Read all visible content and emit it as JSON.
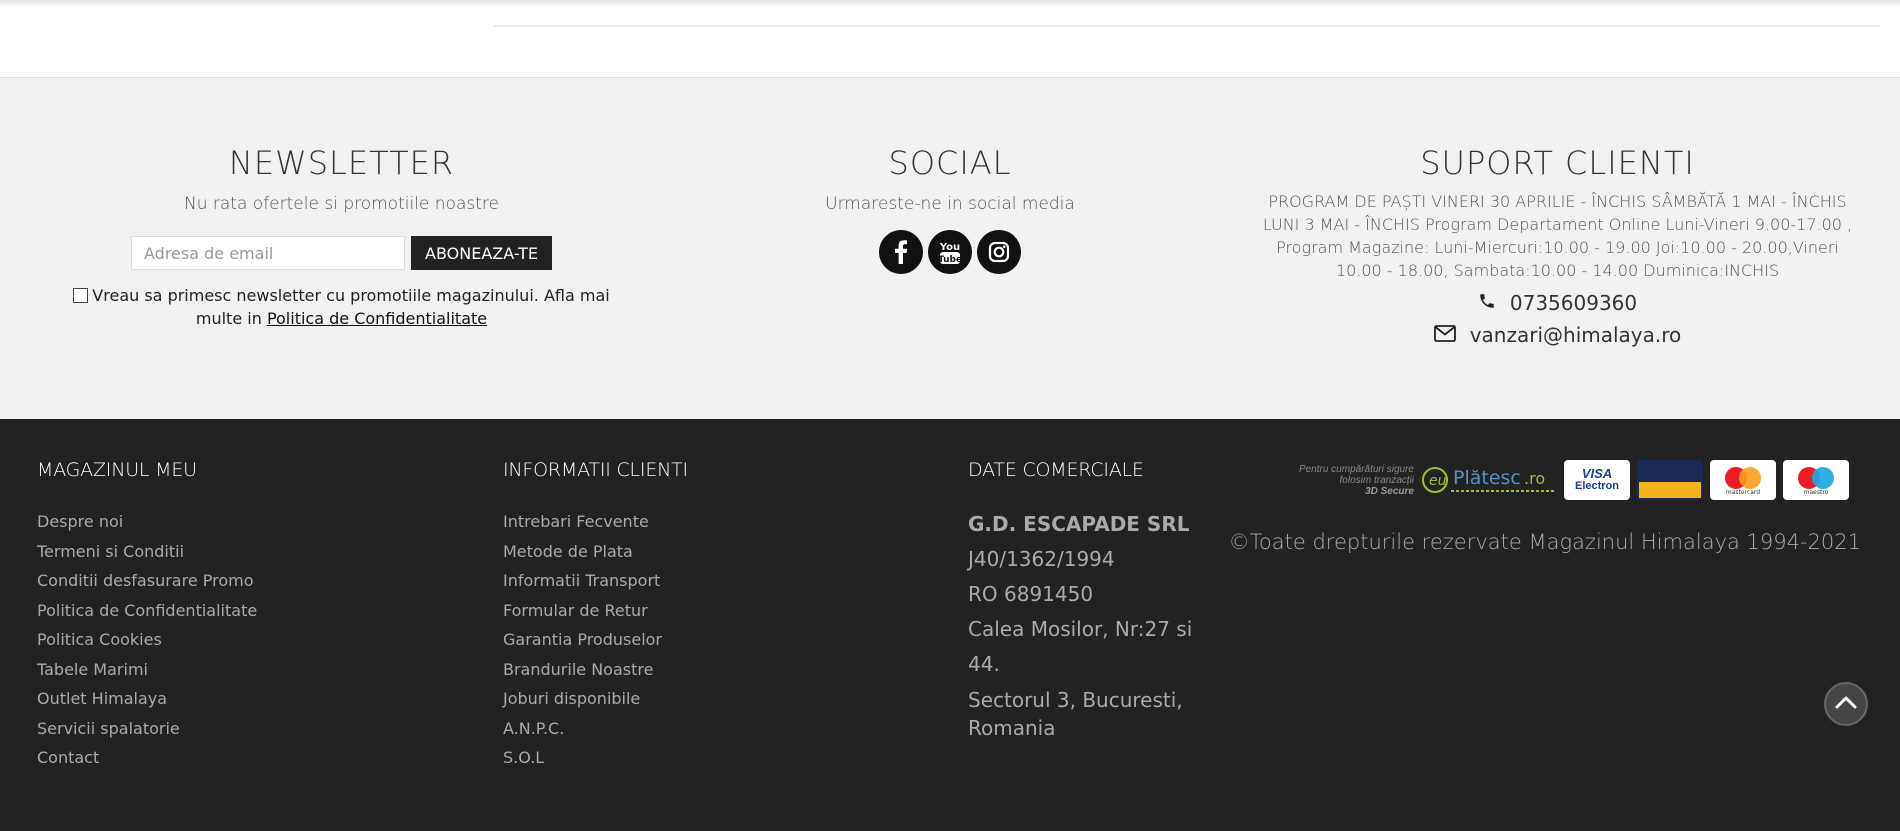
{
  "newsletter": {
    "title": "NEWSLETTER",
    "subtitle": "Nu rata ofertele si promotiile noastre",
    "email_placeholder": "Adresa de email",
    "subscribe_label": "ABONEAZA-TE",
    "consent_text": "Vreau sa primesc newsletter cu promotiile magazinului. Afla mai multe in",
    "consent_link": "Politica de Confidentialitate"
  },
  "social": {
    "title": "SOCIAL",
    "subtitle": "Urmareste-ne in social media",
    "icons": [
      "facebook-icon",
      "youtube-icon",
      "instagram-icon"
    ]
  },
  "support": {
    "title": "SUPORT CLIENTI",
    "schedule": "PROGRAM DE PAȘTI VINERI 30 APRILIE - ÎNCHIS SÂMBĂTĂ 1 MAI - ÎNCHIS LUNI 3 MAI - ÎNCHIS Program Departament Online Luni-Vineri 9.00-17.00 , Program Magazine: Luni-Miercuri:10.00 - 19.00 Joi:10.00 - 20.00,Vineri 10.00 - 18.00, Sambata:10.00 - 14.00 Duminica:INCHIS",
    "phone": "0735609360",
    "email": "vanzari@himalaya.ro"
  },
  "footer": {
    "magazin": {
      "title": "MAGAZINUL MEU",
      "items": [
        "Despre noi",
        "Termeni si Conditii",
        "Conditii desfasurare Promo",
        "Politica de Confidentialitate",
        "Politica Cookies",
        "Tabele Marimi",
        "Outlet Himalaya",
        "Servicii spalatorie",
        "Contact"
      ]
    },
    "informatii": {
      "title": "INFORMATII CLIENTI",
      "items": [
        "Intrebari Fecvente",
        "Metode de Plata",
        "Informatii Transport",
        "Formular de Retur",
        "Garantia Produselor",
        "Brandurile Noastre",
        "Joburi disponibile",
        "A.N.P.C.",
        "S.O.L"
      ]
    },
    "comerciale": {
      "title": "DATE COMERCIALE",
      "company": "G.D. ESCAPADE SRL",
      "reg": "J40/1362/1994",
      "cui": "RO 6891450",
      "address1": "Calea Mosilor, Nr:27 si 44.",
      "address2": "Sectorul 3, Bucuresti, Romania"
    },
    "payments": {
      "secure_line1": "Pentru cumpărături sigure",
      "secure_line2": "folosim tranzacții",
      "secure_line3": "3D Secure",
      "platesc_eu": "eu",
      "platesc_name": "Plătesc",
      "platesc_tld": ".ro",
      "visa": "VISA",
      "visa_sub": "Electron",
      "mastercard": "mastercard",
      "maestro": "maestro"
    },
    "copyright": "©Toate drepturile rezervate Magazinul Himalaya 1994-2021"
  }
}
